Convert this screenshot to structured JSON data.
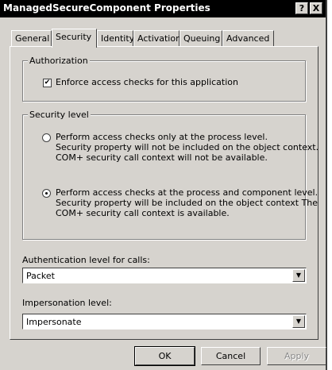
{
  "window": {
    "title": "ManagedSecureComponent Properties",
    "help_label": "?",
    "close_label": "X"
  },
  "tabs": [
    {
      "label": "General"
    },
    {
      "label": "Security"
    },
    {
      "label": "Identity"
    },
    {
      "label": "Activation"
    },
    {
      "label": "Queuing"
    },
    {
      "label": "Advanced"
    }
  ],
  "active_tab": "Security",
  "authorization": {
    "legend": "Authorization",
    "enforce_label": "Enforce access checks for this application",
    "enforce_checked": true,
    "check_glyph": "✔"
  },
  "security_level": {
    "legend": "Security level",
    "options": [
      {
        "lines": [
          "Perform access checks only at the process level.",
          "Security property will not be included on the object context.",
          "COM+ security call context will not be available."
        ],
        "selected": false
      },
      {
        "lines": [
          "Perform access checks at the process and component level.",
          "Security property will be included on the object context  The",
          "COM+ security call context is available."
        ],
        "selected": true
      }
    ]
  },
  "authentication": {
    "label": "Authentication level for calls:",
    "value": "Packet"
  },
  "impersonation": {
    "label": "Impersonation level:",
    "value": "Impersonate"
  },
  "dropdown_glyph": "▼",
  "buttons": {
    "ok": "OK",
    "cancel": "Cancel",
    "apply": "Apply"
  }
}
